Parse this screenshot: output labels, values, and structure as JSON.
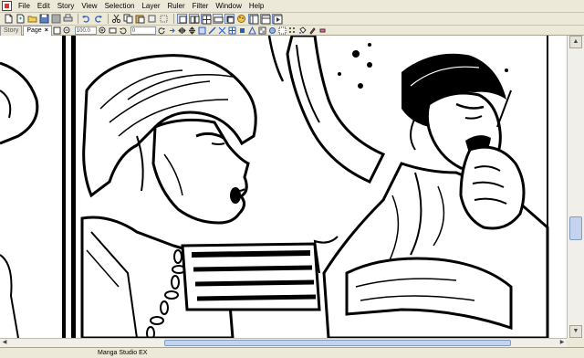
{
  "menubar": {
    "items": [
      "File",
      "Edit",
      "Story",
      "View",
      "Selection",
      "Layer",
      "Ruler",
      "Filter",
      "Window",
      "Help"
    ]
  },
  "toolbar2": {
    "tabs": [
      {
        "label": "Story"
      },
      {
        "label": "Page"
      }
    ],
    "tab_close": "×",
    "zoom_value": "100.0",
    "rotate_value": "0"
  },
  "statusbar": {
    "text": "Manga Studio EX"
  },
  "colors": {
    "chrome": "#ece9d8",
    "canvas": "#ffffff",
    "ink": "#000000",
    "scroll_thumb": "#c5d3f0"
  }
}
